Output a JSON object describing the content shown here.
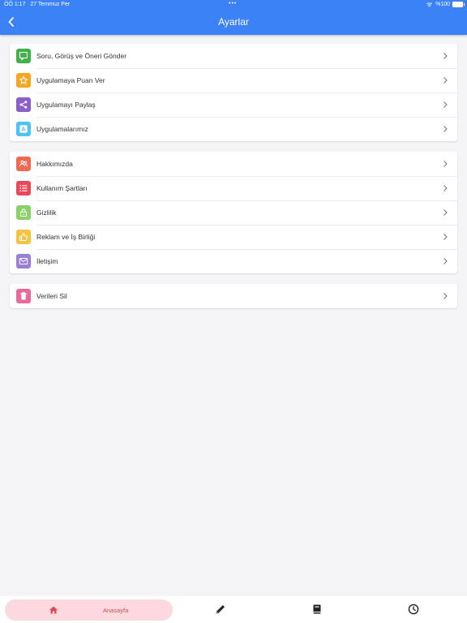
{
  "status_bar": {
    "time": "ÖÖ 1:17",
    "date": "27 Temmuz Per",
    "dots": "•••",
    "battery": "%100"
  },
  "header": {
    "title": "Ayarlar"
  },
  "colors": {
    "header": "#3b82f6",
    "home_tab_bg": "#fbd9de",
    "home_tab_text": "#e34556"
  },
  "sections": [
    [
      {
        "label": "Soru, Görüş ve Öneri Gönder",
        "icon": "chat-icon",
        "color": "#43b14b"
      },
      {
        "label": "Uygulamaya Puan Ver",
        "icon": "star-icon",
        "color": "#f5a623"
      },
      {
        "label": "Uygulamayı Paylaş",
        "icon": "share-icon",
        "color": "#8b5fc8"
      },
      {
        "label": "Uygulamalarımız",
        "icon": "app-store-icon",
        "color": "#4fc3f7"
      }
    ],
    [
      {
        "label": "Hakkımızda",
        "icon": "people-icon",
        "color": "#f06a52"
      },
      {
        "label": "Kullanım Şartları",
        "icon": "list-icon",
        "color": "#e8495a"
      },
      {
        "label": "Gizlilik",
        "icon": "lock-icon",
        "color": "#8bd16a"
      },
      {
        "label": "Reklam ve İş Birliği",
        "icon": "thumbs-up-icon",
        "color": "#f5c242"
      },
      {
        "label": "İletişim",
        "icon": "mail-icon",
        "color": "#9b7fd6"
      }
    ],
    [
      {
        "label": "Verileri Sil",
        "icon": "trash-icon",
        "color": "#e86a9a"
      }
    ]
  ],
  "tabbar": {
    "home_label": "Anasayfa",
    "items": [
      "home-icon",
      "pencil-icon",
      "book-icon",
      "clock-icon"
    ]
  }
}
